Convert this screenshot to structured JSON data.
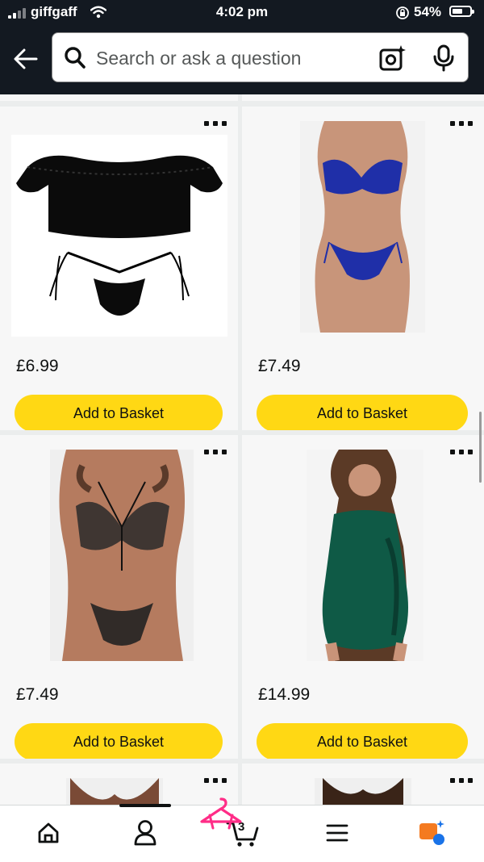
{
  "status_bar": {
    "carrier": "giffgaff",
    "time": "4:02 pm",
    "battery": "54%"
  },
  "search": {
    "placeholder": "Search or ask a question",
    "value": ""
  },
  "products": [
    {
      "price": "£6.99",
      "button": "Add to Basket",
      "image": "black-off-shoulder-lingerie-set"
    },
    {
      "price": "£7.49",
      "button": "Add to Basket",
      "image": "blue-lace-lingerie-set"
    },
    {
      "price": "£7.49",
      "button": "Add to Basket",
      "image": "black-mesh-bralette-set"
    },
    {
      "price": "£14.99",
      "button": "Add to Basket",
      "image": "green-satin-chemise"
    }
  ],
  "bottom_nav": {
    "items": [
      "home-icon",
      "account-icon",
      "basket-icon",
      "menu-icon",
      "rufus-icon"
    ],
    "basket_count": "3",
    "active": "account-icon"
  },
  "colors": {
    "header": "#131921",
    "button": "#ffd814",
    "promo_hanger": "#ff2d87"
  }
}
